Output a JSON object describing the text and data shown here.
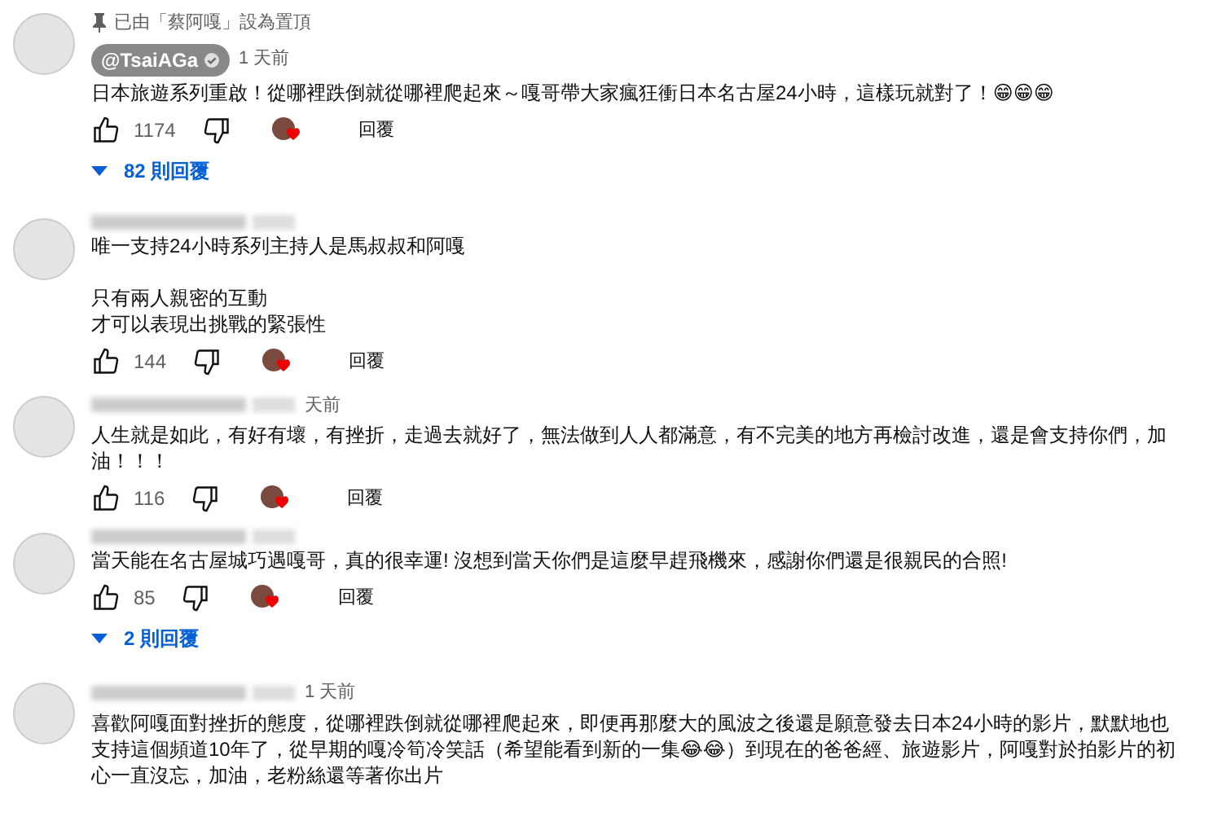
{
  "comments": [
    {
      "pinned_by": "已由「蔡阿嘎」設為置頂",
      "author": "@TsaiAGa",
      "verified": true,
      "time": "1 天前",
      "paragraphs": [
        [
          "日本旅遊系列重啟！從哪裡跌倒就從哪裡爬起來～嘎哥帶大家瘋狂衝日本名古屋24小時，這樣玩就對了！😁😁😁"
        ]
      ],
      "likes": "1174",
      "creator_hearted": true,
      "reply": "回覆",
      "replies": "82 則回覆"
    },
    {
      "paragraphs": [
        [
          "唯一支持24小時系列主持人是馬叔叔和阿嘎"
        ],
        [
          "只有兩人親密的互動",
          "才可以表現出挑戰的緊張性"
        ]
      ],
      "likes": "144",
      "creator_hearted": true,
      "reply": "回覆"
    },
    {
      "time": "天前",
      "paragraphs": [
        [
          "人生就是如此，有好有壞，有挫折，走過去就好了，無法做到人人都滿意，有不完美的地方再檢討改進，還是會支持你們，加油！！！"
        ]
      ],
      "likes": "116",
      "creator_hearted": true,
      "reply": "回覆"
    },
    {
      "paragraphs": [
        [
          "當天能在名古屋城巧遇嘎哥，真的很幸運! 沒想到當天你們是這麼早趕飛機來，感謝你們還是很親民的合照!"
        ]
      ],
      "likes": "85",
      "creator_hearted": true,
      "reply": "回覆",
      "replies": "2 則回覆"
    },
    {
      "time": "1 天前",
      "paragraphs": [
        [
          "喜歡阿嘎面對挫折的態度，從哪裡跌倒就從哪裡爬起來，即便再那麼大的風波之後還是願意發去日本24小時的影片，默默地也支持這個頻道10年了，從早期的嘎冷筍冷笑話（希望能看到新的一集😂😂）到現在的爸爸經、旅遊影片，阿嘎對於拍影片的初心一直沒忘，加油，老粉絲還等著你出片"
        ]
      ]
    }
  ]
}
